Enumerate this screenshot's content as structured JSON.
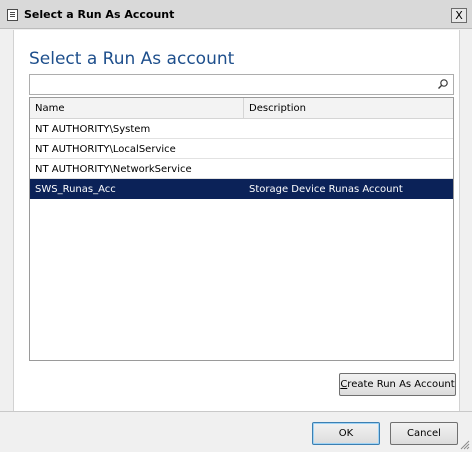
{
  "window": {
    "title": "Select a Run As Account",
    "close_glyph": "X"
  },
  "heading": "Select a Run As account",
  "search": {
    "value": "",
    "placeholder": ""
  },
  "list": {
    "columns": [
      "Name",
      "Description"
    ],
    "rows": [
      {
        "name": "NT AUTHORITY\\System",
        "description": ""
      },
      {
        "name": "NT AUTHORITY\\LocalService",
        "description": ""
      },
      {
        "name": "NT AUTHORITY\\NetworkService",
        "description": ""
      },
      {
        "name": "SWS_Runas_Acc",
        "description": "Storage Device Runas Account",
        "selected": true
      }
    ]
  },
  "buttons": {
    "create_prefix": "C",
    "create_rest": "reate Run As Account",
    "ok": "OK",
    "cancel": "Cancel"
  },
  "colors": {
    "heading": "#1e4f8c",
    "selection": "#0b2258"
  },
  "icons": {
    "app": "window-icon",
    "search": "magnifier-icon",
    "close": "close-icon",
    "resize": "resize-grip-icon"
  }
}
